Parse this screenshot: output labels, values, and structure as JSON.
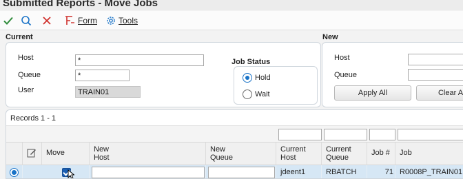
{
  "window": {
    "title": "Submitted Reports - Move Jobs"
  },
  "toolbar": {
    "ok_icon": "check-icon",
    "find_icon": "search-icon",
    "cancel_icon": "close-icon",
    "form_label": "Form",
    "tools_label": "Tools"
  },
  "current": {
    "section_label": "Current",
    "host_label": "Host",
    "host_value": "*",
    "queue_label": "Queue",
    "queue_value": "*",
    "user_label": "User",
    "user_value": "TRAIN01",
    "job_status_label": "Job Status",
    "status_options": [
      "Hold",
      "Wait"
    ],
    "status_selected": "Hold"
  },
  "new": {
    "section_label": "New",
    "host_label": "Host",
    "queue_label": "Queue",
    "apply_all_label": "Apply All",
    "clear_all_label": "Clear A"
  },
  "grid": {
    "records_label": "Records 1 - 1",
    "columns": {
      "move": "Move",
      "new_host_1": "New",
      "new_host_2": "Host",
      "new_queue_1": "New",
      "new_queue_2": "Queue",
      "current_host_1": "Current",
      "current_host_2": "Host",
      "current_queue_1": "Current",
      "current_queue_2": "Queue",
      "job_num": "Job #",
      "job": "Job"
    },
    "rows": [
      {
        "selected": true,
        "move_checked": true,
        "new_host": "",
        "new_queue": "",
        "current_host": "jdeent1",
        "current_queue": "RBATCH",
        "job_num": "71",
        "job": "R0008P_TRAIN01"
      }
    ]
  },
  "colors": {
    "accent": "#1a73c7",
    "selected_row": "#d6e7f5",
    "check_green": "#2e8b3a",
    "cancel_red": "#d0312d"
  }
}
